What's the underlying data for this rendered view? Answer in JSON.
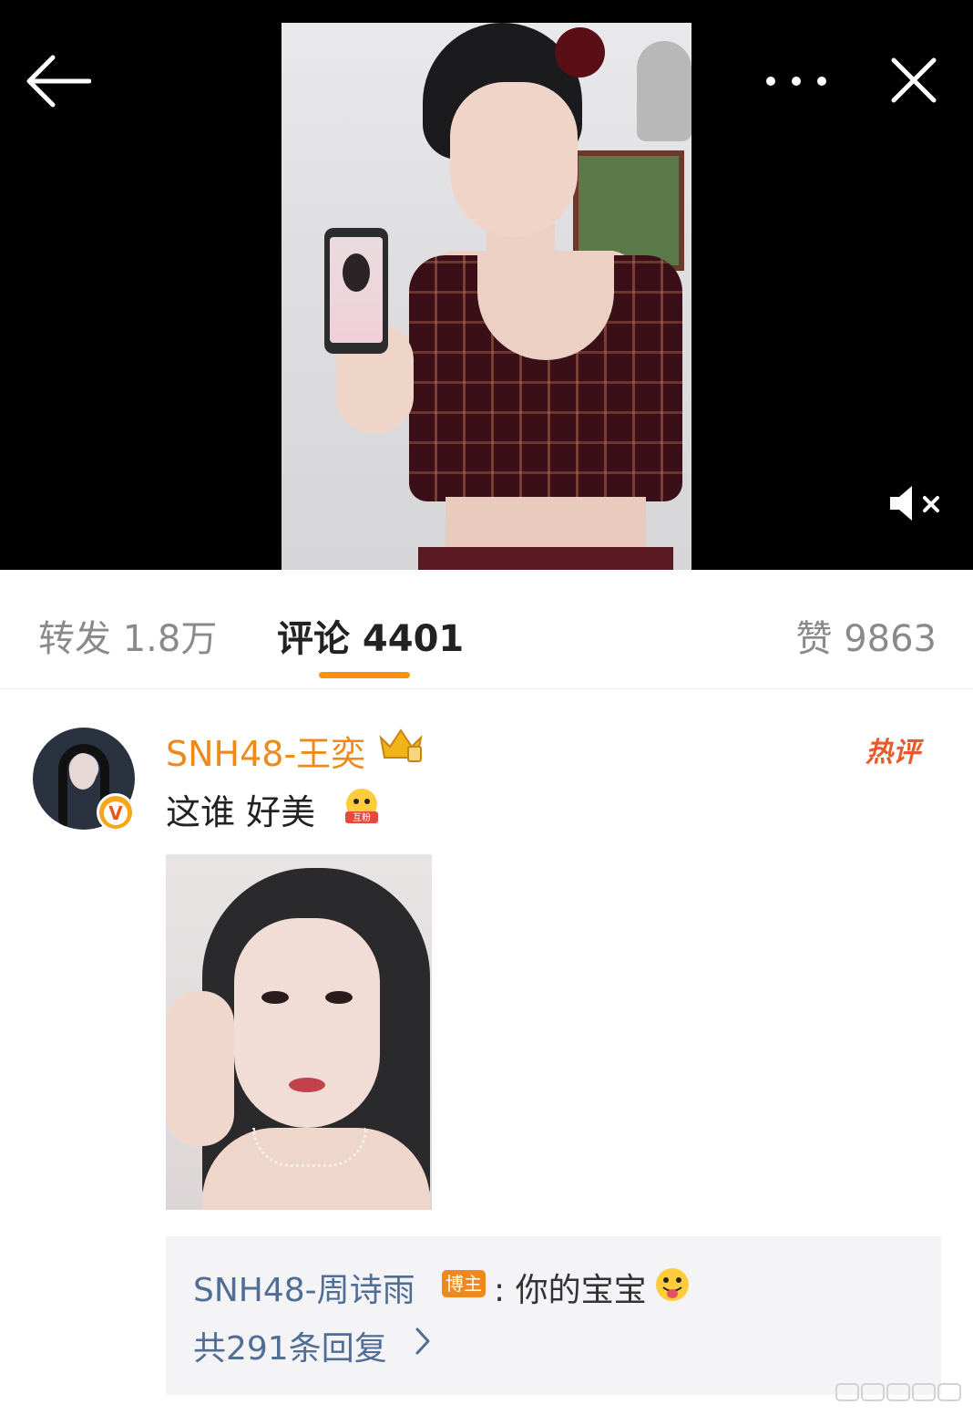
{
  "tabs": {
    "repost": "转发 1.8万",
    "comments": "评论 4401",
    "likes": "赞 9863"
  },
  "comment": {
    "author": "SNH48-王奕",
    "hot_label": "热评",
    "text": "这谁 好美",
    "verified_mark": "V",
    "emoji_label": "互粉"
  },
  "reply": {
    "author": "SNH48-周诗雨",
    "author_badge": "博主",
    "text": ": 你的宝宝",
    "count_label": "共291条回复"
  },
  "colors": {
    "accent": "#f5940b",
    "username": "#f0891b",
    "reply_link": "#4f6d95",
    "hot": "#e85a2a"
  },
  "icons": [
    "back-arrow-icon",
    "more-icon",
    "close-icon",
    "mute-icon",
    "crown-icon",
    "fan-emoji-icon",
    "tongue-emoji-icon",
    "chevron-right-icon"
  ]
}
